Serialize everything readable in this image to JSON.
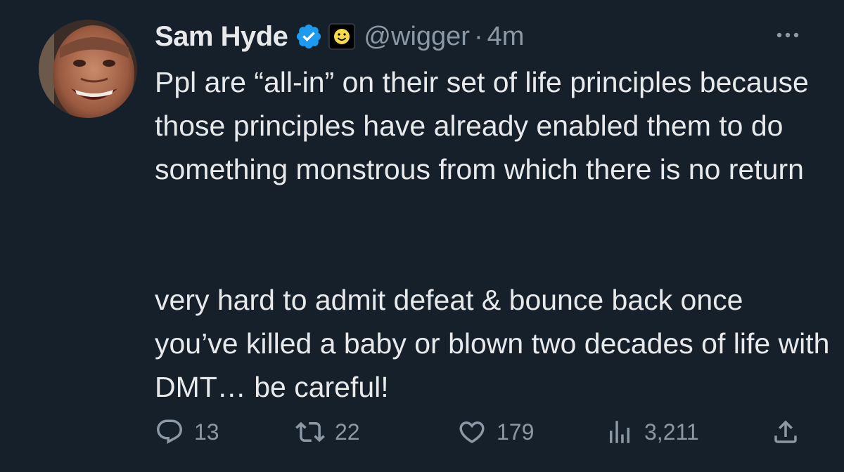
{
  "tweet": {
    "author_name": "Sam Hyde",
    "handle": "@wigger",
    "separator": "·",
    "time": "4m",
    "verified_icon": "verified-badge-icon",
    "affiliate_icon": "smiley-badge-icon",
    "text_paragraphs": [
      "Ppl are “all-in” on their set of life principles because those principles have already enabled them to do something monstrous from which there is no return",
      "very hard to admit defeat & bounce back once you’ve killed a baby or blown two decades of life with DMT… be careful!"
    ]
  },
  "actions": {
    "replies": "13",
    "reposts": "22",
    "likes": "179",
    "views": "3,211"
  },
  "colors": {
    "background": "#16202b",
    "text": "#e7e9ea",
    "secondary": "#8b98a5",
    "verified": "#1d9bf0"
  }
}
